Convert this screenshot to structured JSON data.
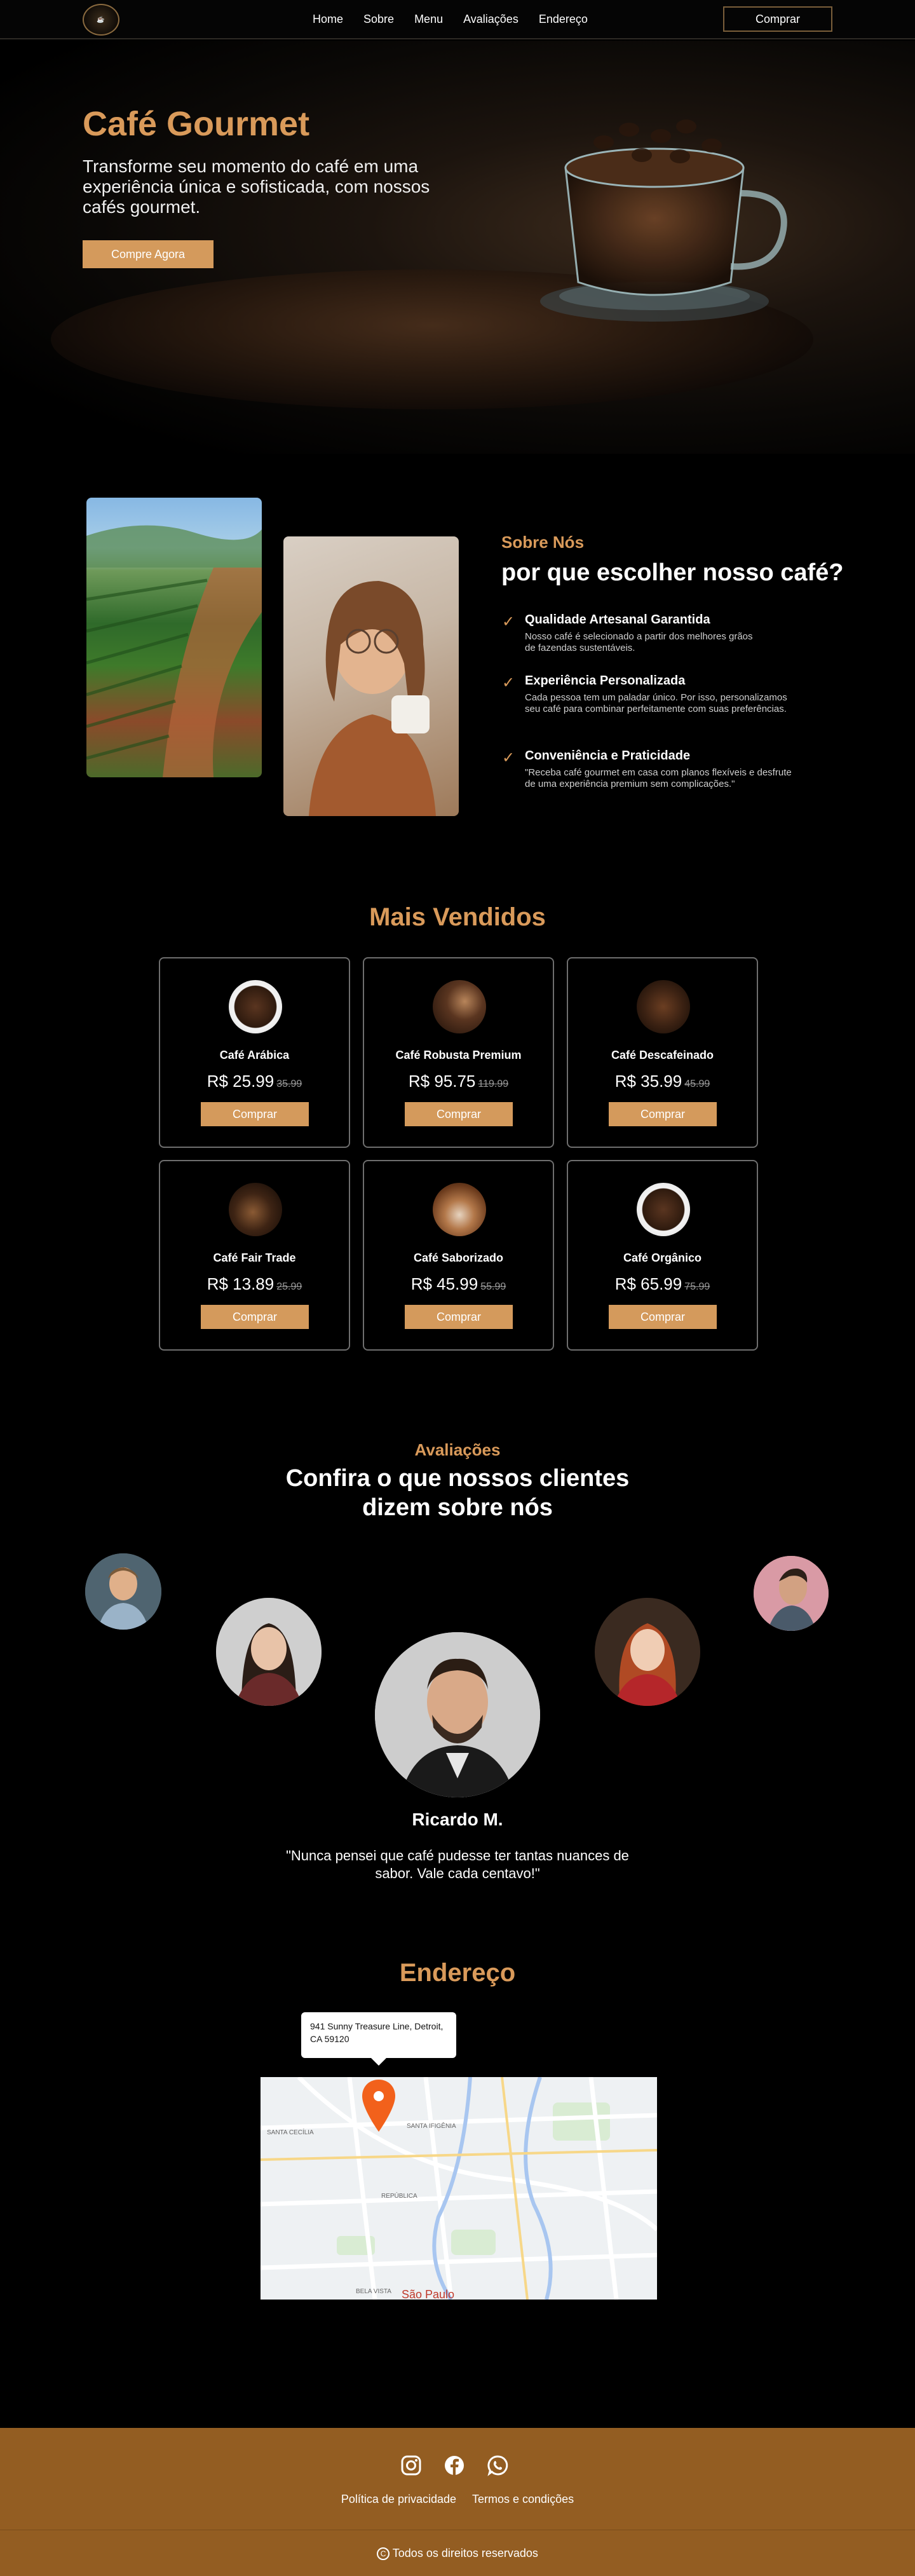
{
  "nav": {
    "links": [
      "Home",
      "Sobre",
      "Menu",
      "Avaliações",
      "Endereço"
    ],
    "button": "Comprar"
  },
  "hero": {
    "title": "Café Gourmet",
    "subtitle": "Transforme seu momento do café em uma experiência única e sofisticada, com nossos cafés gourmet.",
    "button": "Compre Agora"
  },
  "about": {
    "tag": "Sobre Nós",
    "title": "por que escolher nosso café?",
    "features": [
      {
        "title": "Qualidade Artesanal Garantida",
        "text": "Nosso café é selecionado a partir dos melhores grãos de fazendas sustentáveis."
      },
      {
        "title": "Experiência Personalizada",
        "text": "Cada pessoa tem um paladar único. Por isso, personalizamos seu café para combinar perfeitamente com suas preferências."
      },
      {
        "title": "Conveniência e Praticidade",
        "text": "\"Receba café gourmet em casa com planos flexíveis e desfrute de uma experiência premium sem complicações.\""
      }
    ]
  },
  "best": {
    "title": "Mais Vendidos",
    "products": [
      {
        "name": "Café Arábica",
        "price": "R$ 25.99",
        "old": "35.99",
        "buy": "Comprar"
      },
      {
        "name": "Café Robusta Premium",
        "price": "R$ 95.75",
        "old": "119.99",
        "buy": "Comprar"
      },
      {
        "name": "Café Descafeinado",
        "price": "R$ 35.99",
        "old": "45.99",
        "buy": "Comprar"
      },
      {
        "name": "Café Fair Trade",
        "price": "R$ 13.89",
        "old": "25.99",
        "buy": "Comprar"
      },
      {
        "name": "Café Saborizado",
        "price": "R$ 45.99",
        "old": "55.99",
        "buy": "Comprar"
      },
      {
        "name": "Café Orgânico",
        "price": "R$ 65.99",
        "old": "75.99",
        "buy": "Comprar"
      }
    ]
  },
  "reviews": {
    "tag": "Avaliações",
    "title": "Confira o que nossos clientes dizem sobre nós",
    "name": "Ricardo M.",
    "quote": "\"Nunca pensei que café pudesse ter tantas nuances de sabor. Vale cada centavo!\""
  },
  "address": {
    "title": "Endereço",
    "callout": "941 Sunny Treasure Line, Detroit, CA 59120",
    "map_label": "São Paulo",
    "districts": [
      "SANTA CECÍLIA",
      "SANTA IFIGÊNIA",
      "REPÚBLICA",
      "BELA VISTA"
    ]
  },
  "footer": {
    "links": [
      "Política de privacidade",
      "Termos e condições"
    ],
    "copyright": "Todos os direitos reservados",
    "copyright_icon": "copyright-icon"
  },
  "colors": {
    "accent": "#d99a5a",
    "button": "#d49a5c",
    "footer": "#935d22"
  }
}
